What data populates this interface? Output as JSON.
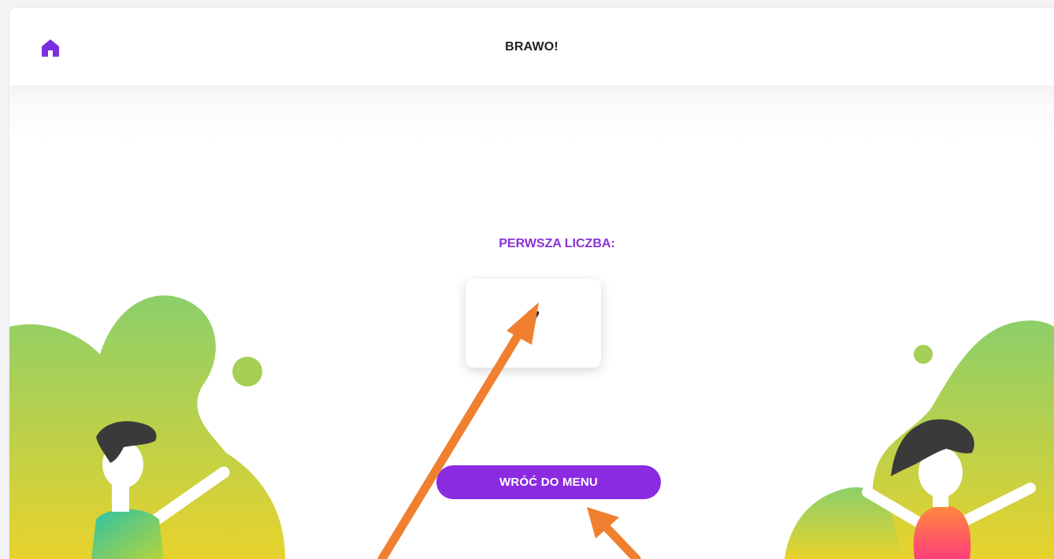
{
  "header": {
    "title": "BRAWO!",
    "home_icon": "home-icon"
  },
  "main": {
    "label": "PERWSZA LICZBA:",
    "value": "7",
    "button_label": "WRÓĆ DO MENU"
  },
  "colors": {
    "accent": "#8a2be2",
    "blob_top": "#8ccf6a",
    "blob_bottom": "#e8d22c",
    "annotation_arrow": "#f08030"
  }
}
